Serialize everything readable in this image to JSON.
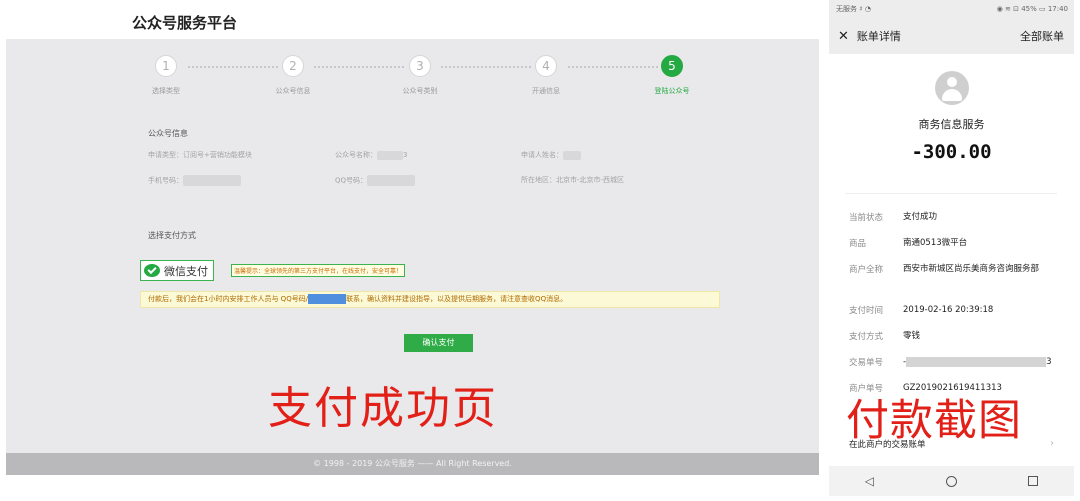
{
  "web": {
    "title": "公众号服务平台",
    "steps": [
      {
        "num": "1",
        "label": "选择类型"
      },
      {
        "num": "2",
        "label": "公众号信息"
      },
      {
        "num": "3",
        "label": "公众号类别"
      },
      {
        "num": "4",
        "label": "开通信息"
      },
      {
        "num": "5",
        "label": "登陆公众号"
      }
    ],
    "active_step": 5,
    "account_info_title": "公众号信息",
    "apply_type": "申请类型：订阅号+营销功能模块",
    "account_name": "公众号名称：",
    "account_name_tail": "3",
    "applicant_name": "申请人姓名：",
    "phone_label": "手机号码：",
    "qq_label": "QQ号码：",
    "region": "所在地区：北京市-北京市-西城区",
    "payment_title": "选择支付方式",
    "wechat_pay_label": "微信支付",
    "tip": "温馨提示：全球领先的第三方支付平台，在线支付，安全可靠！",
    "notice_before": "付款后，我们会在1小时内安排工作人员与 QQ号码/",
    "notice_after": "联系，确认资料并建设指导，以及提供后期服务，请注意查收QQ消息。",
    "confirm_button": "确认支付",
    "footer": "© 1998 - 2019 公众号服务 —— All Right Reserved."
  },
  "overlay": {
    "left_text": "支付成功页",
    "right_text": "付款截图"
  },
  "phone": {
    "status_left": "无服务 ♯ ◔",
    "status_right": "◉ ≋ ⊡ 45% ▭ 17:40",
    "close_glyph": "✕",
    "header_title": "账单详情",
    "header_action": "全部账单",
    "merchant_name": "商务信息服务",
    "amount": "-300.00",
    "rows": [
      {
        "key": "当前状态",
        "value": "支付成功"
      },
      {
        "key": "商品",
        "value": "南通0513微平台"
      },
      {
        "key": "商户全称",
        "value": "西安市新城区尚乐美商务咨询服务部"
      },
      {
        "key": "支付时间",
        "value": "2019-02-16 20:39:18"
      },
      {
        "key": "支付方式",
        "value": "零钱"
      },
      {
        "key": "交易单号",
        "value_prefix": "-",
        "value_suffix": "3"
      },
      {
        "key": "商户单号",
        "value": "GZ20190216194113​13"
      }
    ],
    "trade_link": "在此商户的交易账单",
    "chevron": "›",
    "nav_back": "◁"
  },
  "colors": {
    "accent_green": "#25a942",
    "overlay_red": "#e22018",
    "notice_bg": "#fbf9d6",
    "masked_blue": "#4f8fde"
  }
}
